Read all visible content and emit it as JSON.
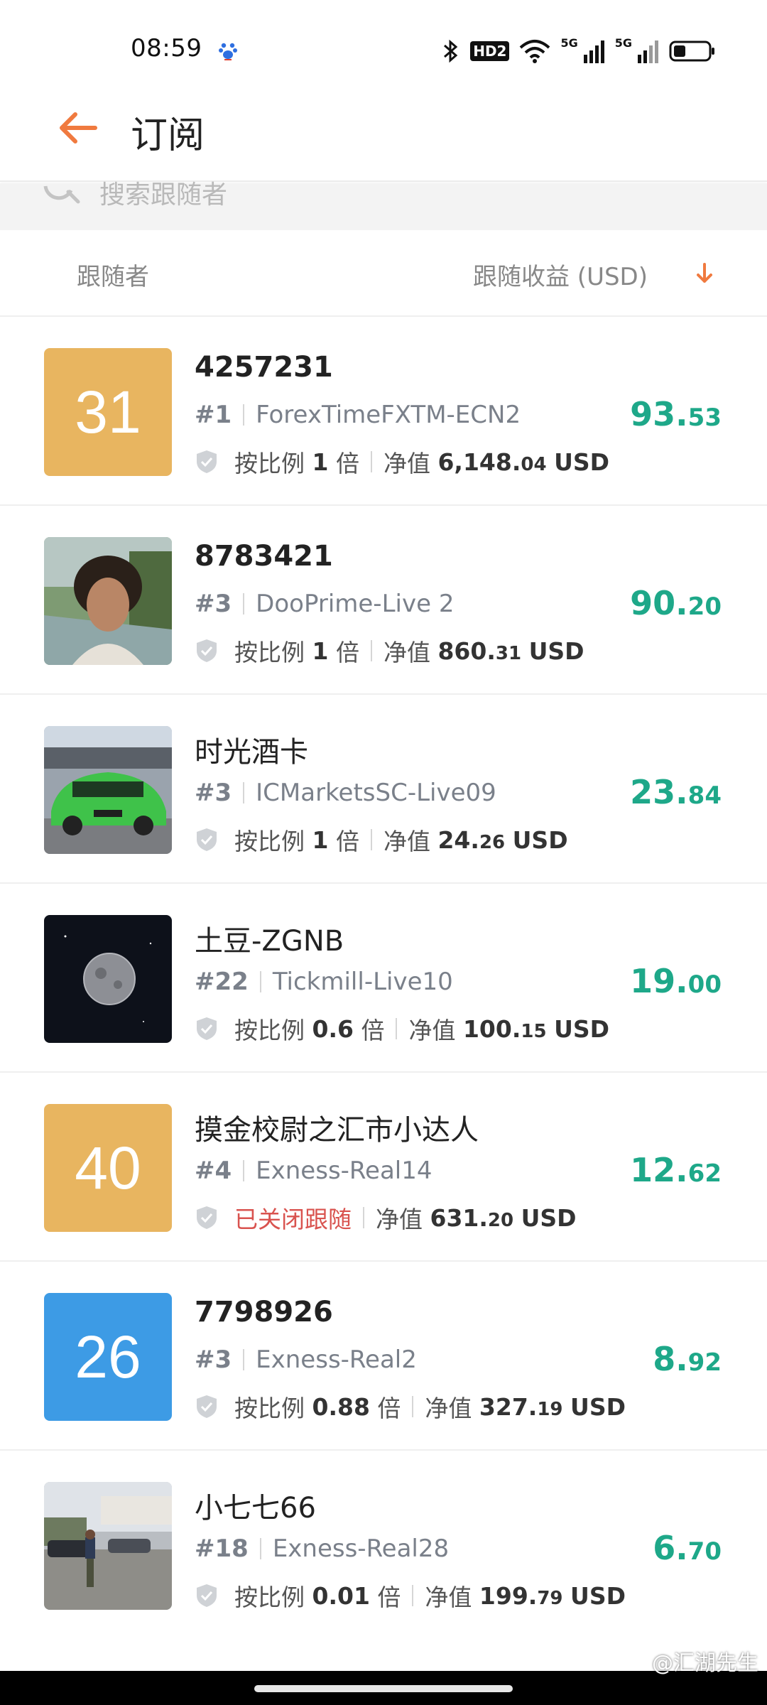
{
  "status_bar": {
    "time": "08:59",
    "hd_label": "HD2",
    "net1": "5G",
    "net2": "5G"
  },
  "header": {
    "title": "订阅",
    "back_icon": "arrow-left-icon",
    "accent_color": "#f07a3f"
  },
  "search": {
    "placeholder": "搜索跟随者"
  },
  "columns": {
    "follower": "跟随者",
    "profit": "跟随收益 (USD)",
    "sort_icon": "arrow-down-icon"
  },
  "labels": {
    "ratio_prefix": "按比例",
    "ratio_suffix": "倍",
    "equity_prefix": "净值",
    "currency": "USD"
  },
  "followers": [
    {
      "avatar_type": "number",
      "avatar_text": "31",
      "avatar_color": "#e8b560",
      "name": "4257231",
      "rank": "#1",
      "server": "ForexTimeFXTM-ECN2",
      "ratio": "1",
      "equity_int": "6,148.",
      "equity_dec": "04",
      "profit_int": "93.",
      "profit_dec": "53",
      "closed": false
    },
    {
      "avatar_type": "photo",
      "avatar_desc": "person-photo",
      "name": "8783421",
      "rank": "#3",
      "server": "DooPrime-Live 2",
      "ratio": "1",
      "equity_int": "860.",
      "equity_dec": "31",
      "profit_int": "90.",
      "profit_dec": "20",
      "closed": false
    },
    {
      "avatar_type": "photo",
      "avatar_desc": "green-car-photo",
      "name": "时光酒卡",
      "rank": "#3",
      "server": "ICMarketsSC-Live09",
      "ratio": "1",
      "equity_int": "24.",
      "equity_dec": "26",
      "profit_int": "23.",
      "profit_dec": "84",
      "closed": false
    },
    {
      "avatar_type": "photo",
      "avatar_desc": "moon-photo",
      "name": "土豆-ZGNB",
      "rank": "#22",
      "server": "Tickmill-Live10",
      "ratio": "0.6",
      "equity_int": "100.",
      "equity_dec": "15",
      "profit_int": "19.",
      "profit_dec": "00",
      "closed": false
    },
    {
      "avatar_type": "number",
      "avatar_text": "40",
      "avatar_color": "#e8b560",
      "name": "摸金校尉之汇市小达人",
      "rank": "#4",
      "server": "Exness-Real14",
      "closed_text": "已关闭跟随",
      "equity_int": "631.",
      "equity_dec": "20",
      "profit_int": "12.",
      "profit_dec": "62",
      "closed": true
    },
    {
      "avatar_type": "number",
      "avatar_text": "26",
      "avatar_color": "#3d9be5",
      "name": "7798926",
      "rank": "#3",
      "server": "Exness-Real2",
      "ratio": "0.88",
      "equity_int": "327.",
      "equity_dec": "19",
      "profit_int": "8.",
      "profit_dec": "92",
      "closed": false
    },
    {
      "avatar_type": "photo",
      "avatar_desc": "parking-lot-photo",
      "name": "小七七66",
      "rank": "#18",
      "server": "Exness-Real28",
      "ratio": "0.01",
      "equity_int": "199.",
      "equity_dec": "79",
      "profit_int": "6.",
      "profit_dec": "70",
      "closed": false
    }
  ],
  "watermark": "@汇湖先生",
  "colors": {
    "profit_green": "#1ea889",
    "closed_red": "#d9534f"
  }
}
